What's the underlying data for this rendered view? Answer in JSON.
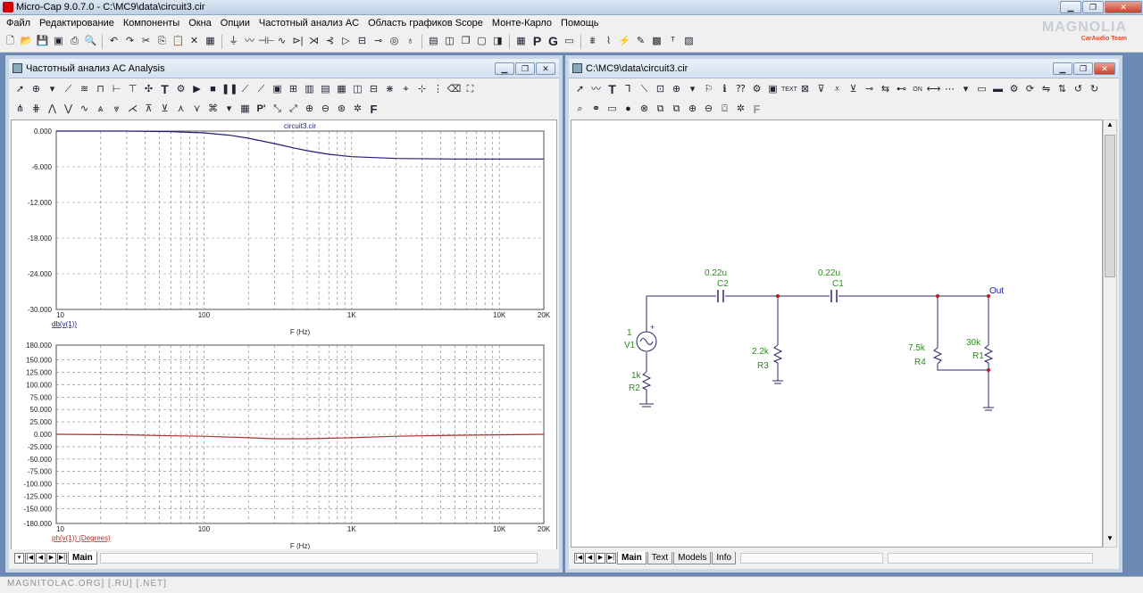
{
  "app": {
    "title": "Micro-Cap 9.0.7.0 - C:\\MC9\\data\\circuit3.cir"
  },
  "brand": {
    "name": "MAGNOLIA",
    "sub": "CarAudio Team"
  },
  "menu": [
    "Файл",
    "Редактирование",
    "Компоненты",
    "Окна",
    "Опции",
    "Частотный анализ AC",
    "Область графиков Scope",
    "Монте-Карло",
    "Помощь"
  ],
  "ac_window": {
    "title": "Частотный анализ AC Analysis",
    "plot_title": "circuit3.cir",
    "tab": "Main",
    "plot1": {
      "yticks": [
        "0.000",
        "-6.000",
        "-12.000",
        "-18.000",
        "-24.000",
        "-30.000"
      ],
      "xticks": [
        "10",
        "100",
        "1K",
        "10K",
        "20K"
      ],
      "expr": "db(v(1))",
      "xlabel": "F (Hz)"
    },
    "plot2": {
      "yticks": [
        "180.000",
        "150.000",
        "125.000",
        "100.000",
        "75.000",
        "50.000",
        "25.000",
        "0.000",
        "-25.000",
        "-50.000",
        "-75.000",
        "-100.000",
        "-125.000",
        "-150.000",
        "-180.000"
      ],
      "xticks": [
        "10",
        "100",
        "1K",
        "10K",
        "20K"
      ],
      "expr": "ph(v(1)) (Degrees)",
      "xlabel": "F (Hz)"
    }
  },
  "chart_data": [
    {
      "type": "line",
      "title": "circuit3.cir",
      "xlabel": "F (Hz)",
      "ylabel": "db(v(1))",
      "xscale": "log",
      "xlim": [
        10,
        20000
      ],
      "ylim": [
        -30,
        0
      ],
      "grid": true,
      "color": "#1c1c7a",
      "series": [
        {
          "name": "db(v(1))",
          "x": [
            10,
            30,
            60,
            100,
            150,
            200,
            300,
            400,
            500,
            700,
            1000,
            2000,
            5000,
            10000,
            20000
          ],
          "y": [
            0,
            0,
            -0.1,
            -0.3,
            -0.7,
            -1.2,
            -2.1,
            -2.8,
            -3.3,
            -3.9,
            -4.3,
            -4.6,
            -4.7,
            -4.7,
            -4.7
          ]
        }
      ]
    },
    {
      "type": "line",
      "xlabel": "F (Hz)",
      "ylabel": "ph(v(1)) (Degrees)",
      "xscale": "log",
      "xlim": [
        10,
        20000
      ],
      "ylim": [
        -180,
        180
      ],
      "grid": true,
      "color": "#b03030",
      "series": [
        {
          "name": "ph(v(1)) (Degrees)",
          "x": [
            10,
            30,
            60,
            100,
            200,
            300,
            500,
            1000,
            2000,
            5000,
            10000,
            20000
          ],
          "y": [
            0,
            -1,
            -3,
            -4,
            -7,
            -9,
            -9,
            -7,
            -4,
            -2,
            -1,
            0
          ]
        }
      ]
    }
  ],
  "schem_window": {
    "title": "C:\\MC9\\data\\circuit3.cir",
    "tabs": [
      "Main",
      "Text",
      "Models",
      "Info"
    ]
  },
  "circuit": {
    "C2": {
      "name": "C2",
      "value": "0.22u"
    },
    "C1": {
      "name": "C1",
      "value": "0.22u"
    },
    "V1": {
      "name": "V1",
      "value": "1"
    },
    "R2": {
      "name": "R2",
      "value": "1k"
    },
    "R3": {
      "name": "R3",
      "value": "2.2k"
    },
    "R4": {
      "name": "R4",
      "value": "7.5k"
    },
    "R1": {
      "name": "R1",
      "value": "30k"
    },
    "out": "Out"
  },
  "taskbar": {
    "watermark": "MAGNITOLAC.ORG] [.RU] [.NET]"
  },
  "colors": {
    "grid": "#808080",
    "wire": "#2a2a6a",
    "comp": "#2a2a6a",
    "label": "#2d8a1e",
    "node": "#c01818",
    "out": "#1a1aa0"
  }
}
